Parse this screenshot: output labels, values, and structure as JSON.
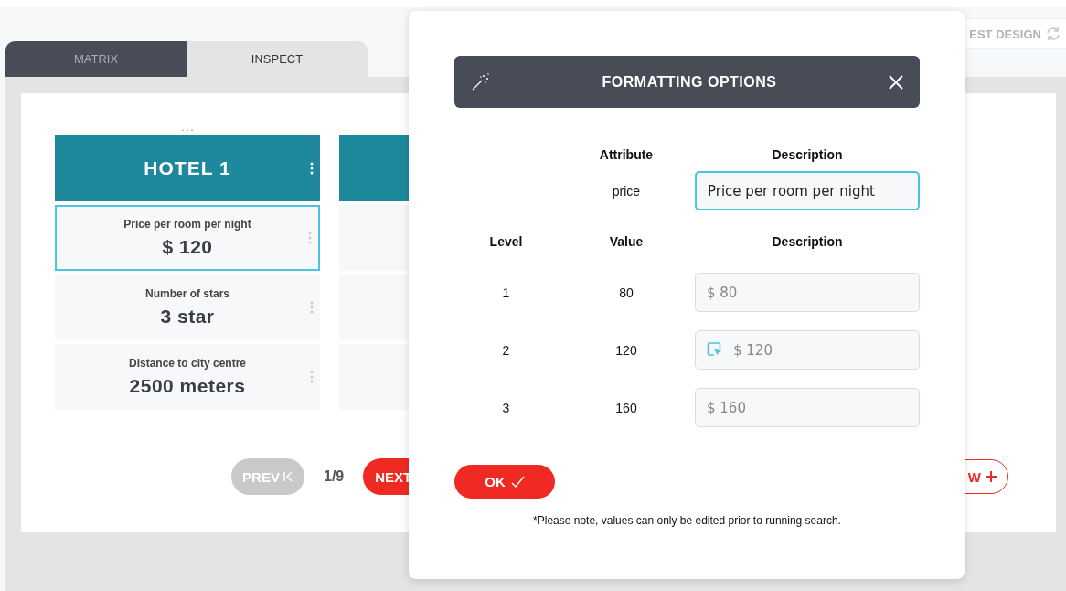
{
  "tabs": [
    {
      "label": "MATRIX",
      "selected": false
    },
    {
      "label": "INSPECT",
      "selected": true
    }
  ],
  "top_button": {
    "label": "EST DESIGN"
  },
  "hotel_columns": [
    {
      "title": "HOTEL 1",
      "attributes": [
        {
          "label": "Price per room per night",
          "value": "$ 120",
          "selected": true
        },
        {
          "label": "Number of stars",
          "value": "3 star",
          "selected": false
        },
        {
          "label": "Distance to city centre",
          "value": "2500 meters",
          "selected": false
        }
      ]
    },
    {
      "attributes": [
        {
          "selected": false
        },
        {
          "selected": false
        },
        {
          "selected": false
        }
      ]
    }
  ],
  "pagination": {
    "prev": "PREV",
    "prev_disabled": true,
    "page": "1/9",
    "next": "NEXT"
  },
  "right_button": {
    "label": "W"
  },
  "dialog": {
    "title": "FORMATTING OPTIONS",
    "attribute_header": "Attribute",
    "description_header": "Description",
    "attribute": "price",
    "description": "Price per room per night",
    "description_focused": true,
    "level_header": "Level",
    "value_header": "Value",
    "level_description_header": "Description",
    "levels": [
      {
        "level": "1",
        "value": "80",
        "placeholder": "$ 80",
        "pointer": false
      },
      {
        "level": "2",
        "value": "120",
        "placeholder": "$ 120",
        "pointer": true
      },
      {
        "level": "3",
        "value": "160",
        "placeholder": "$ 160",
        "pointer": false
      }
    ],
    "ok": "OK",
    "note": "*Please note, values can only be edited prior to running search."
  }
}
